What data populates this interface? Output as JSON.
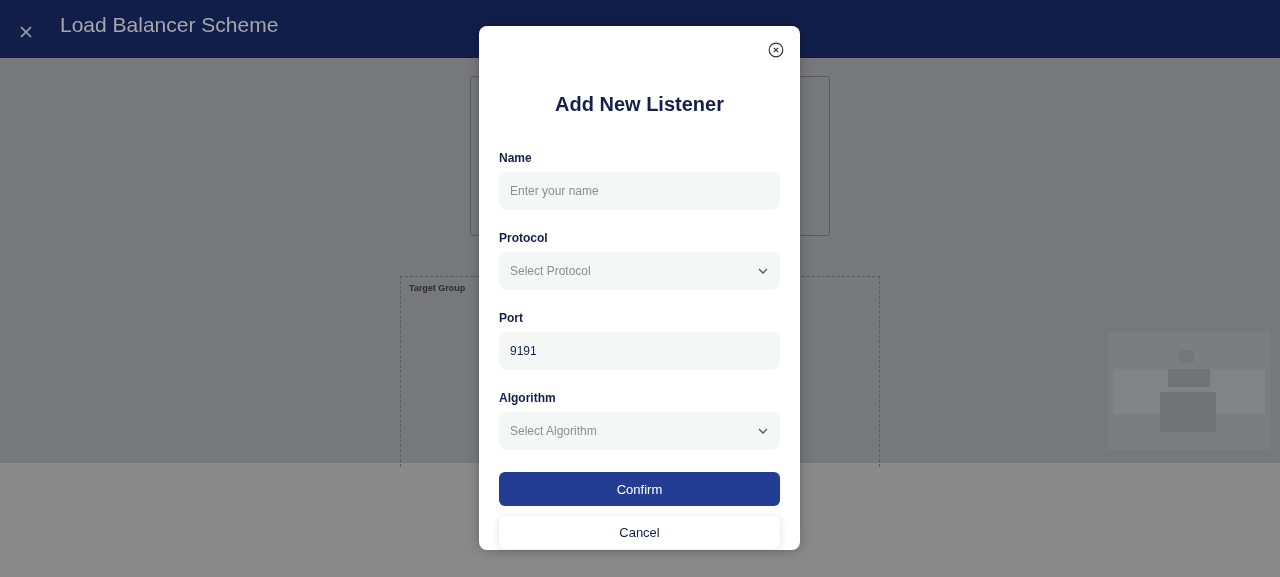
{
  "header": {
    "title": "Load Balancer Scheme"
  },
  "canvas": {
    "group_label": "Target Group"
  },
  "dialog": {
    "title": "Add New Listener",
    "fields": [
      {
        "kind": "text",
        "label": "Name",
        "placeholder": "Enter your name"
      },
      {
        "kind": "select",
        "label": "Protocol",
        "placeholder": "Select Protocol"
      },
      {
        "kind": "text",
        "label": "Port",
        "value": "9191"
      },
      {
        "kind": "select",
        "label": "Algorithm",
        "placeholder": "Select Algorithm"
      }
    ],
    "confirm": "Confirm",
    "cancel": "Cancel"
  }
}
